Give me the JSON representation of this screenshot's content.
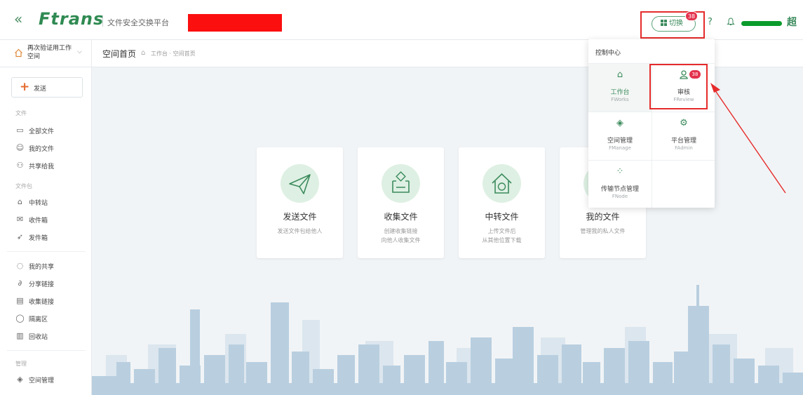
{
  "header": {
    "collapse_icon": "«",
    "logo": "Ftrans",
    "platform_name": "文件安全交换平台",
    "switch_label": "切换",
    "switch_badge": "38",
    "help_icon": "?",
    "user_char": "超"
  },
  "workspace": {
    "name": "再次验证用工作空间"
  },
  "breadcrumb": {
    "title": "空间首页",
    "path": "工作台 · 空间首页"
  },
  "sidebar": {
    "send_label": "发送",
    "sections": {
      "files": "文件",
      "mailbox": "文件包",
      "manage": "管理"
    },
    "files_items": [
      {
        "label": "全部文件",
        "icon": "folder-icon"
      },
      {
        "label": "我的文件",
        "icon": "user-file-icon"
      },
      {
        "label": "共享给我",
        "icon": "share-users-icon"
      }
    ],
    "mailbox_items": [
      {
        "label": "中转站",
        "icon": "transfer-icon"
      },
      {
        "label": "收件箱",
        "icon": "inbox-icon"
      },
      {
        "label": "发件箱",
        "icon": "outbox-icon"
      }
    ],
    "misc_items": [
      {
        "label": "我的共享",
        "icon": "share-icon"
      },
      {
        "label": "分享链接",
        "icon": "link-icon"
      },
      {
        "label": "收集链接",
        "icon": "collect-icon"
      },
      {
        "label": "隔离区",
        "icon": "shield-icon"
      },
      {
        "label": "回收站",
        "icon": "trash-icon"
      }
    ],
    "manage_items": [
      {
        "label": "空间管理",
        "icon": "layers-icon"
      }
    ]
  },
  "cards": [
    {
      "title": "发送文件",
      "subtitle": "发送文件包给他人",
      "icon": "paper-plane-icon"
    },
    {
      "title": "收集文件",
      "subtitle": "创建收集链接\n向他人收集文件",
      "icon": "collect-box-icon"
    },
    {
      "title": "中转文件",
      "subtitle": "上传文件后\n从其他位置下载",
      "icon": "relay-house-icon"
    },
    {
      "title": "我的文件",
      "subtitle": "管理我的私人文件",
      "icon": "my-files-icon"
    }
  ],
  "control_center": {
    "title": "控制中心",
    "tiles": [
      {
        "label": "工作台",
        "sub": "FWorks",
        "icon": "home-icon",
        "active": true
      },
      {
        "label": "审核",
        "sub": "FReview",
        "icon": "review-user-icon",
        "badge": "38"
      },
      {
        "label": "空间管理",
        "sub": "FManage",
        "icon": "layers-icon"
      },
      {
        "label": "平台管理",
        "sub": "FAdmin",
        "icon": "gear-icon"
      },
      {
        "label": "传输节点管理",
        "sub": "FNode",
        "icon": "nodes-icon"
      }
    ]
  },
  "colors": {
    "brand_green": "#2f8a52",
    "accent_green": "#3c8b5d",
    "badge_red": "#e3334d",
    "annotation_red": "#e62b2b",
    "skyline": "#b9cfe0"
  }
}
